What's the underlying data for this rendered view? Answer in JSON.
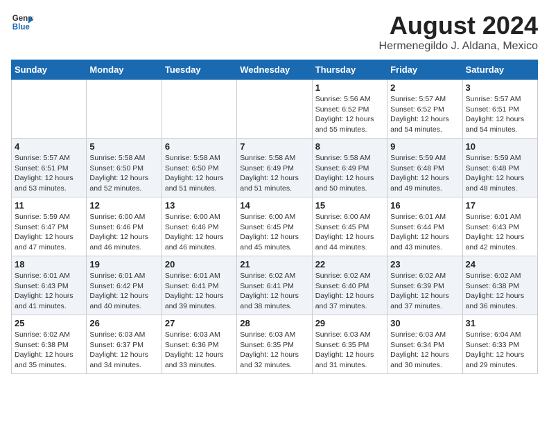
{
  "header": {
    "logo_line1": "General",
    "logo_line2": "Blue",
    "month": "August 2024",
    "location": "Hermenegildo J. Aldana, Mexico"
  },
  "weekdays": [
    "Sunday",
    "Monday",
    "Tuesday",
    "Wednesday",
    "Thursday",
    "Friday",
    "Saturday"
  ],
  "weeks": [
    [
      {
        "day": "",
        "info": ""
      },
      {
        "day": "",
        "info": ""
      },
      {
        "day": "",
        "info": ""
      },
      {
        "day": "",
        "info": ""
      },
      {
        "day": "1",
        "info": "Sunrise: 5:56 AM\nSunset: 6:52 PM\nDaylight: 12 hours\nand 55 minutes."
      },
      {
        "day": "2",
        "info": "Sunrise: 5:57 AM\nSunset: 6:52 PM\nDaylight: 12 hours\nand 54 minutes."
      },
      {
        "day": "3",
        "info": "Sunrise: 5:57 AM\nSunset: 6:51 PM\nDaylight: 12 hours\nand 54 minutes."
      }
    ],
    [
      {
        "day": "4",
        "info": "Sunrise: 5:57 AM\nSunset: 6:51 PM\nDaylight: 12 hours\nand 53 minutes."
      },
      {
        "day": "5",
        "info": "Sunrise: 5:58 AM\nSunset: 6:50 PM\nDaylight: 12 hours\nand 52 minutes."
      },
      {
        "day": "6",
        "info": "Sunrise: 5:58 AM\nSunset: 6:50 PM\nDaylight: 12 hours\nand 51 minutes."
      },
      {
        "day": "7",
        "info": "Sunrise: 5:58 AM\nSunset: 6:49 PM\nDaylight: 12 hours\nand 51 minutes."
      },
      {
        "day": "8",
        "info": "Sunrise: 5:58 AM\nSunset: 6:49 PM\nDaylight: 12 hours\nand 50 minutes."
      },
      {
        "day": "9",
        "info": "Sunrise: 5:59 AM\nSunset: 6:48 PM\nDaylight: 12 hours\nand 49 minutes."
      },
      {
        "day": "10",
        "info": "Sunrise: 5:59 AM\nSunset: 6:48 PM\nDaylight: 12 hours\nand 48 minutes."
      }
    ],
    [
      {
        "day": "11",
        "info": "Sunrise: 5:59 AM\nSunset: 6:47 PM\nDaylight: 12 hours\nand 47 minutes."
      },
      {
        "day": "12",
        "info": "Sunrise: 6:00 AM\nSunset: 6:46 PM\nDaylight: 12 hours\nand 46 minutes."
      },
      {
        "day": "13",
        "info": "Sunrise: 6:00 AM\nSunset: 6:46 PM\nDaylight: 12 hours\nand 46 minutes."
      },
      {
        "day": "14",
        "info": "Sunrise: 6:00 AM\nSunset: 6:45 PM\nDaylight: 12 hours\nand 45 minutes."
      },
      {
        "day": "15",
        "info": "Sunrise: 6:00 AM\nSunset: 6:45 PM\nDaylight: 12 hours\nand 44 minutes."
      },
      {
        "day": "16",
        "info": "Sunrise: 6:01 AM\nSunset: 6:44 PM\nDaylight: 12 hours\nand 43 minutes."
      },
      {
        "day": "17",
        "info": "Sunrise: 6:01 AM\nSunset: 6:43 PM\nDaylight: 12 hours\nand 42 minutes."
      }
    ],
    [
      {
        "day": "18",
        "info": "Sunrise: 6:01 AM\nSunset: 6:43 PM\nDaylight: 12 hours\nand 41 minutes."
      },
      {
        "day": "19",
        "info": "Sunrise: 6:01 AM\nSunset: 6:42 PM\nDaylight: 12 hours\nand 40 minutes."
      },
      {
        "day": "20",
        "info": "Sunrise: 6:01 AM\nSunset: 6:41 PM\nDaylight: 12 hours\nand 39 minutes."
      },
      {
        "day": "21",
        "info": "Sunrise: 6:02 AM\nSunset: 6:41 PM\nDaylight: 12 hours\nand 38 minutes."
      },
      {
        "day": "22",
        "info": "Sunrise: 6:02 AM\nSunset: 6:40 PM\nDaylight: 12 hours\nand 37 minutes."
      },
      {
        "day": "23",
        "info": "Sunrise: 6:02 AM\nSunset: 6:39 PM\nDaylight: 12 hours\nand 37 minutes."
      },
      {
        "day": "24",
        "info": "Sunrise: 6:02 AM\nSunset: 6:38 PM\nDaylight: 12 hours\nand 36 minutes."
      }
    ],
    [
      {
        "day": "25",
        "info": "Sunrise: 6:02 AM\nSunset: 6:38 PM\nDaylight: 12 hours\nand 35 minutes."
      },
      {
        "day": "26",
        "info": "Sunrise: 6:03 AM\nSunset: 6:37 PM\nDaylight: 12 hours\nand 34 minutes."
      },
      {
        "day": "27",
        "info": "Sunrise: 6:03 AM\nSunset: 6:36 PM\nDaylight: 12 hours\nand 33 minutes."
      },
      {
        "day": "28",
        "info": "Sunrise: 6:03 AM\nSunset: 6:35 PM\nDaylight: 12 hours\nand 32 minutes."
      },
      {
        "day": "29",
        "info": "Sunrise: 6:03 AM\nSunset: 6:35 PM\nDaylight: 12 hours\nand 31 minutes."
      },
      {
        "day": "30",
        "info": "Sunrise: 6:03 AM\nSunset: 6:34 PM\nDaylight: 12 hours\nand 30 minutes."
      },
      {
        "day": "31",
        "info": "Sunrise: 6:04 AM\nSunset: 6:33 PM\nDaylight: 12 hours\nand 29 minutes."
      }
    ]
  ]
}
